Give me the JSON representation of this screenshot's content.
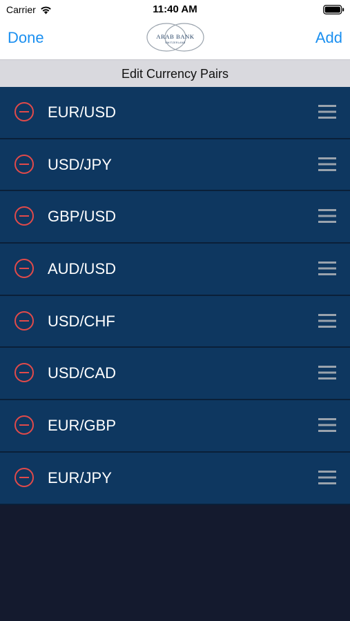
{
  "status_bar": {
    "carrier": "Carrier",
    "time": "11:40 AM"
  },
  "nav": {
    "done_label": "Done",
    "add_label": "Add",
    "logo_text": "ARAB BANK",
    "logo_subtext": "SWITZERLAND"
  },
  "section": {
    "title": "Edit Currency Pairs"
  },
  "pairs": [
    {
      "label": "EUR/USD"
    },
    {
      "label": "USD/JPY"
    },
    {
      "label": "GBP/USD"
    },
    {
      "label": "AUD/USD"
    },
    {
      "label": "USD/CHF"
    },
    {
      "label": "USD/CAD"
    },
    {
      "label": "EUR/GBP"
    },
    {
      "label": "EUR/JPY"
    }
  ],
  "colors": {
    "accent": "#1a8ff0",
    "row_background": "#0e3760",
    "delete_icon": "#e24a4a",
    "page_background": "#141a2e"
  },
  "icons": {
    "delete": "minus-circle-icon",
    "reorder": "reorder-grip-icon"
  }
}
